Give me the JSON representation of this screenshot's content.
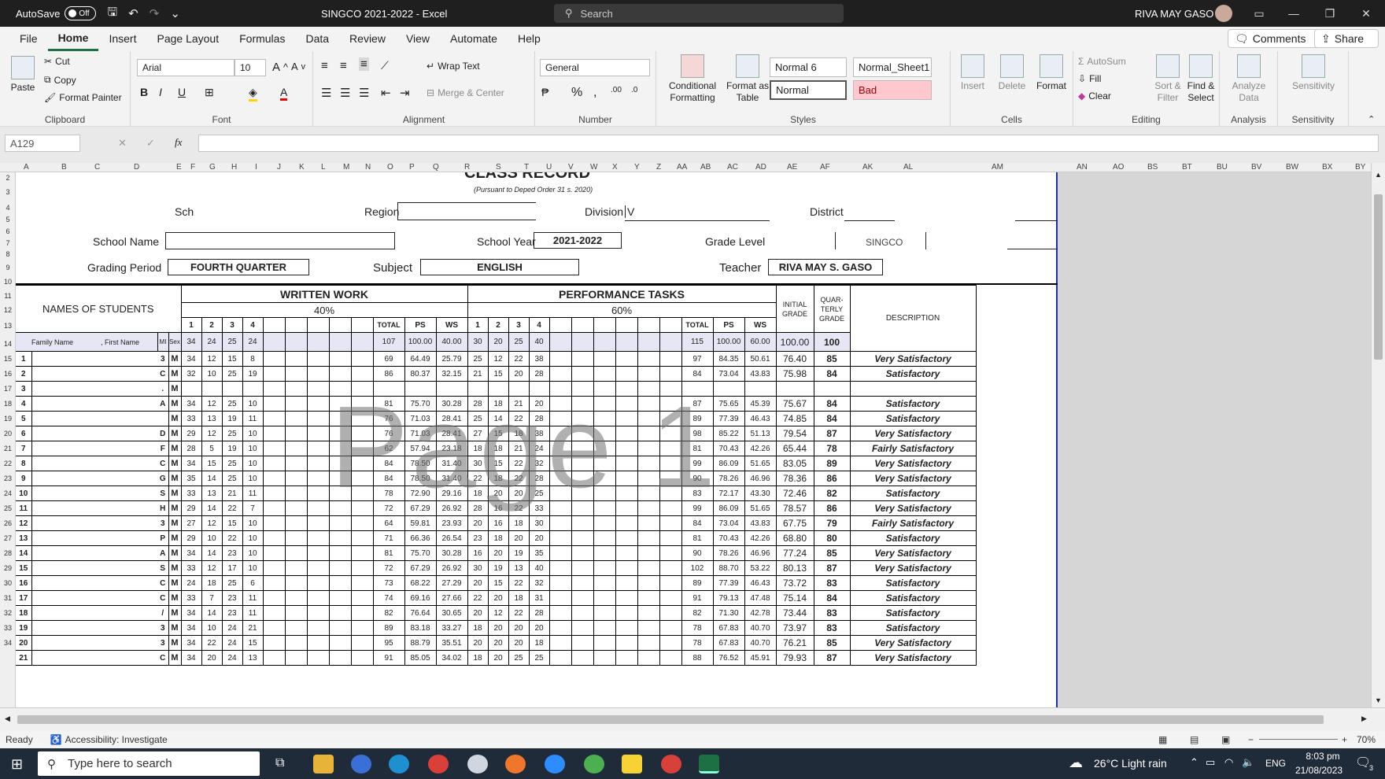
{
  "titlebar": {
    "autosave": "AutoSave",
    "autosave_state": "Off",
    "doc_title": "SINGCO 2021-2022  -  Excel",
    "search": "Search",
    "user": "RIVA MAY  GASO"
  },
  "menu": {
    "items": [
      "File",
      "Home",
      "Insert",
      "Page Layout",
      "Formulas",
      "Data",
      "Review",
      "View",
      "Automate",
      "Help"
    ],
    "active": "Home",
    "comments": "Comments",
    "share": "Share"
  },
  "ribbon": {
    "clipboard": {
      "paste": "Paste",
      "cut": "Cut",
      "copy": "Copy",
      "format_painter": "Format Painter",
      "label": "Clipboard"
    },
    "font": {
      "name": "Arial",
      "size": "10",
      "label": "Font"
    },
    "alignment": {
      "wrap": "Wrap Text",
      "merge": "Merge & Center",
      "label": "Alignment"
    },
    "number": {
      "format": "General",
      "label": "Number"
    },
    "styles": {
      "cond": "Conditional Formatting",
      "fmt_table": "Format as Table",
      "s1": "Normal 6",
      "s2": "Normal_Sheet1",
      "s3": "Normal",
      "s4": "Bad",
      "label": "Styles"
    },
    "cells": {
      "insert": "Insert",
      "delete": "Delete",
      "format": "Format",
      "label": "Cells"
    },
    "editing": {
      "autosum": "AutoSum",
      "fill": "Fill",
      "clear": "Clear",
      "sort": "Sort & Filter",
      "find": "Find & Select",
      "label": "Editing"
    },
    "analysis": {
      "btn": "Analyze Data",
      "label": "Analysis"
    },
    "sensitivity": {
      "btn": "Sensitivity",
      "label": "Sensitivity"
    }
  },
  "formula": {
    "namebox": "A129",
    "fx": "fx"
  },
  "columns": [
    "A",
    "B",
    "C",
    "D",
    "E",
    "F",
    "G",
    "H",
    "I",
    "J",
    "K",
    "L",
    "M",
    "N",
    "O",
    "P",
    "Q",
    "R",
    "S",
    "T",
    "U",
    "V",
    "W",
    "X",
    "Y",
    "Z",
    "AA",
    "AB",
    "AC",
    "AD",
    "AE",
    "AF",
    "AK",
    "AL",
    "AM",
    "AN",
    "AO",
    "BS",
    "BT",
    "BU",
    "BV",
    "BW",
    "BX",
    "BY"
  ],
  "rows": [
    "2",
    "3",
    "4",
    "5",
    "6",
    "7",
    "8",
    "9",
    "10",
    "11",
    "12",
    "13",
    "14",
    "15",
    "16",
    "17",
    "18",
    "19",
    "20",
    "21",
    "22",
    "23",
    "24",
    "25",
    "26",
    "27",
    "28",
    "29",
    "30",
    "31",
    "32",
    "33",
    "34"
  ],
  "sheet": {
    "title": "CLASS RECORD",
    "subtitle": "(Pursuant to Deped Order 31 s. 2020)",
    "region": "Region",
    "school_short": "Sch",
    "division": "Division",
    "division_val": "V",
    "district": "District",
    "school_name": "School Name",
    "school_year_label": "School Year",
    "school_year": "2021-2022",
    "grade_level": "Grade Level",
    "singco": "SINGCO",
    "grading_label": "Grading Period",
    "grading": "FOURTH QUARTER",
    "subject_label": "Subject",
    "subject": "ENGLISH",
    "teacher_label": "Teacher",
    "teacher": "RIVA MAY S. GASO",
    "names_header": "NAMES OF STUDENTS",
    "ww": "WRITTEN WORK",
    "ww_pct": "40%",
    "pt": "PERFORMANCE TASKS",
    "pt_pct": "60%",
    "initial": "INITIAL GRADE",
    "quarterly": "QUAR- TERLY GRADE",
    "description": "DESCRIPTION",
    "family": "Family Name",
    "first": "First Name",
    "mi": "MI",
    "sex": "Sex",
    "cols": [
      "1",
      "2",
      "3",
      "4",
      "TOTAL",
      "PS",
      "WS"
    ],
    "hps": {
      "ww": [
        "34",
        "24",
        "25",
        "24"
      ],
      "ww_total": "107",
      "ww_ps": "100.00",
      "ww_ws": "40.00",
      "pt": [
        "30",
        "20",
        "25",
        "40"
      ],
      "pt_total": "115",
      "pt_ps": "100.00",
      "pt_ws": "60.00",
      "initial": "100.00",
      "quarterly": "100"
    },
    "watermark": "Page 1",
    "students": [
      {
        "no": "1",
        "mi": "3",
        "sex": "M",
        "ww": [
          "34",
          "12",
          "15",
          "8"
        ],
        "wt": "69",
        "wp": "64.49",
        "ws": "25.79",
        "pt": [
          "25",
          "12",
          "22",
          "38"
        ],
        "ptt": "97",
        "pp": "84.35",
        "pws": "50.61",
        "ig": "76.40",
        "qg": "85",
        "d": "Very Satisfactory"
      },
      {
        "no": "2",
        "mi": "C",
        "sex": "M",
        "ww": [
          "32",
          "10",
          "25",
          "19"
        ],
        "wt": "86",
        "wp": "80.37",
        "ws": "32.15",
        "pt": [
          "21",
          "15",
          "20",
          "28"
        ],
        "ptt": "84",
        "pp": "73.04",
        "pws": "43.83",
        "ig": "75.98",
        "qg": "84",
        "d": "Satisfactory"
      },
      {
        "no": "3",
        "mi": ".",
        "sex": "M",
        "ww": [
          "",
          "",
          "",
          ""
        ],
        "wt": "",
        "wp": "",
        "ws": "",
        "pt": [
          "",
          "",
          "",
          ""
        ],
        "ptt": "",
        "pp": "",
        "pws": "",
        "ig": "",
        "qg": "",
        "d": ""
      },
      {
        "no": "4",
        "mi": "A",
        "sex": "M",
        "ww": [
          "34",
          "12",
          "25",
          "10"
        ],
        "wt": "81",
        "wp": "75.70",
        "ws": "30.28",
        "pt": [
          "28",
          "18",
          "21",
          "20"
        ],
        "ptt": "87",
        "pp": "75.65",
        "pws": "45.39",
        "ig": "75.67",
        "qg": "84",
        "d": "Satisfactory"
      },
      {
        "no": "5",
        "mi": "",
        "sex": "M",
        "ww": [
          "33",
          "13",
          "19",
          "11"
        ],
        "wt": "76",
        "wp": "71.03",
        "ws": "28.41",
        "pt": [
          "25",
          "14",
          "22",
          "28"
        ],
        "ptt": "89",
        "pp": "77.39",
        "pws": "46.43",
        "ig": "74.85",
        "qg": "84",
        "d": "Satisfactory"
      },
      {
        "no": "6",
        "mi": "D",
        "sex": "M",
        "ww": [
          "29",
          "12",
          "25",
          "10"
        ],
        "wt": "76",
        "wp": "71.03",
        "ws": "28.41",
        "pt": [
          "27",
          "15",
          "18",
          "38"
        ],
        "ptt": "98",
        "pp": "85.22",
        "pws": "51.13",
        "ig": "79.54",
        "qg": "87",
        "d": "Very Satisfactory"
      },
      {
        "no": "7",
        "mi": "F",
        "sex": "M",
        "ww": [
          "28",
          "5",
          "19",
          "10"
        ],
        "wt": "62",
        "wp": "57.94",
        "ws": "23.18",
        "pt": [
          "18",
          "18",
          "21",
          "24"
        ],
        "ptt": "81",
        "pp": "70.43",
        "pws": "42.26",
        "ig": "65.44",
        "qg": "78",
        "d": "Fairly Satisfactory"
      },
      {
        "no": "8",
        "mi": "C",
        "sex": "M",
        "ww": [
          "34",
          "15",
          "25",
          "10"
        ],
        "wt": "84",
        "wp": "78.50",
        "ws": "31.40",
        "pt": [
          "30",
          "15",
          "22",
          "32"
        ],
        "ptt": "99",
        "pp": "86.09",
        "pws": "51.65",
        "ig": "83.05",
        "qg": "89",
        "d": "Very Satisfactory"
      },
      {
        "no": "9",
        "mi": "G",
        "sex": "M",
        "ww": [
          "35",
          "14",
          "25",
          "10"
        ],
        "wt": "84",
        "wp": "78.50",
        "ws": "31.40",
        "pt": [
          "22",
          "18",
          "22",
          "28"
        ],
        "ptt": "90",
        "pp": "78.26",
        "pws": "46.96",
        "ig": "78.36",
        "qg": "86",
        "d": "Very Satisfactory"
      },
      {
        "no": "10",
        "mi": "S",
        "sex": "M",
        "ww": [
          "33",
          "13",
          "21",
          "11"
        ],
        "wt": "78",
        "wp": "72.90",
        "ws": "29.16",
        "pt": [
          "18",
          "20",
          "20",
          "25"
        ],
        "ptt": "83",
        "pp": "72.17",
        "pws": "43.30",
        "ig": "72.46",
        "qg": "82",
        "d": "Satisfactory"
      },
      {
        "no": "11",
        "mi": "H",
        "sex": "M",
        "ww": [
          "29",
          "14",
          "22",
          "7"
        ],
        "wt": "72",
        "wp": "67.29",
        "ws": "26.92",
        "pt": [
          "28",
          "16",
          "22",
          "33"
        ],
        "ptt": "99",
        "pp": "86.09",
        "pws": "51.65",
        "ig": "78.57",
        "qg": "86",
        "d": "Very Satisfactory"
      },
      {
        "no": "12",
        "mi": "3",
        "sex": "M",
        "ww": [
          "27",
          "12",
          "15",
          "10"
        ],
        "wt": "64",
        "wp": "59.81",
        "ws": "23.93",
        "pt": [
          "20",
          "16",
          "18",
          "30"
        ],
        "ptt": "84",
        "pp": "73.04",
        "pws": "43.83",
        "ig": "67.75",
        "qg": "79",
        "d": "Fairly Satisfactory"
      },
      {
        "no": "13",
        "mi": "P",
        "sex": "M",
        "ww": [
          "29",
          "10",
          "22",
          "10"
        ],
        "wt": "71",
        "wp": "66.36",
        "ws": "26.54",
        "pt": [
          "23",
          "18",
          "20",
          "20"
        ],
        "ptt": "81",
        "pp": "70.43",
        "pws": "42.26",
        "ig": "68.80",
        "qg": "80",
        "d": "Satisfactory"
      },
      {
        "no": "14",
        "mi": "A",
        "sex": "M",
        "ww": [
          "34",
          "14",
          "23",
          "10"
        ],
        "wt": "81",
        "wp": "75.70",
        "ws": "30.28",
        "pt": [
          "16",
          "20",
          "19",
          "35"
        ],
        "ptt": "90",
        "pp": "78.26",
        "pws": "46.96",
        "ig": "77.24",
        "qg": "85",
        "d": "Very Satisfactory"
      },
      {
        "no": "15",
        "mi": "S",
        "sex": "M",
        "ww": [
          "33",
          "12",
          "17",
          "10"
        ],
        "wt": "72",
        "wp": "67.29",
        "ws": "26.92",
        "pt": [
          "30",
          "19",
          "13",
          "40"
        ],
        "ptt": "102",
        "pp": "88.70",
        "pws": "53.22",
        "ig": "80.13",
        "qg": "87",
        "d": "Very Satisfactory"
      },
      {
        "no": "16",
        "mi": "C",
        "sex": "M",
        "ww": [
          "24",
          "18",
          "25",
          "6"
        ],
        "wt": "73",
        "wp": "68.22",
        "ws": "27.29",
        "pt": [
          "20",
          "15",
          "22",
          "32"
        ],
        "ptt": "89",
        "pp": "77.39",
        "pws": "46.43",
        "ig": "73.72",
        "qg": "83",
        "d": "Satisfactory"
      },
      {
        "no": "17",
        "mi": "C",
        "sex": "M",
        "ww": [
          "33",
          "7",
          "23",
          "11"
        ],
        "wt": "74",
        "wp": "69.16",
        "ws": "27.66",
        "pt": [
          "22",
          "20",
          "18",
          "31"
        ],
        "ptt": "91",
        "pp": "79.13",
        "pws": "47.48",
        "ig": "75.14",
        "qg": "84",
        "d": "Satisfactory"
      },
      {
        "no": "18",
        "mi": "/",
        "sex": "M",
        "ww": [
          "34",
          "14",
          "23",
          "11"
        ],
        "wt": "82",
        "wp": "76.64",
        "ws": "30.65",
        "pt": [
          "20",
          "12",
          "22",
          "28"
        ],
        "ptt": "82",
        "pp": "71.30",
        "pws": "42.78",
        "ig": "73.44",
        "qg": "83",
        "d": "Satisfactory"
      },
      {
        "no": "19",
        "mi": "3",
        "sex": "M",
        "ww": [
          "34",
          "10",
          "24",
          "21"
        ],
        "wt": "89",
        "wp": "83.18",
        "ws": "33.27",
        "pt": [
          "18",
          "20",
          "20",
          "20"
        ],
        "ptt": "78",
        "pp": "67.83",
        "pws": "40.70",
        "ig": "73.97",
        "qg": "83",
        "d": "Satisfactory"
      },
      {
        "no": "20",
        "mi": "3",
        "sex": "M",
        "ww": [
          "34",
          "22",
          "24",
          "15"
        ],
        "wt": "95",
        "wp": "88.79",
        "ws": "35.51",
        "pt": [
          "20",
          "20",
          "20",
          "18"
        ],
        "ptt": "78",
        "pp": "67.83",
        "pws": "40.70",
        "ig": "76.21",
        "qg": "85",
        "d": "Very Satisfactory"
      },
      {
        "no": "21",
        "mi": "C",
        "sex": "M",
        "ww": [
          "34",
          "20",
          "24",
          "13"
        ],
        "wt": "91",
        "wp": "85.05",
        "ws": "34.02",
        "pt": [
          "18",
          "20",
          "25",
          "25"
        ],
        "ptt": "88",
        "pp": "76.52",
        "pws": "45.91",
        "ig": "79.93",
        "qg": "87",
        "d": "Very Satisfactory"
      }
    ]
  },
  "status": {
    "ready": "Ready",
    "accessibility": "Accessibility: Investigate",
    "zoom": "70%"
  },
  "taskbar": {
    "search": "Type here to search",
    "weather": "26°C  Light rain",
    "lang": "ENG",
    "time": "8:03 pm",
    "date": "21/08/2023",
    "notif": "3"
  }
}
